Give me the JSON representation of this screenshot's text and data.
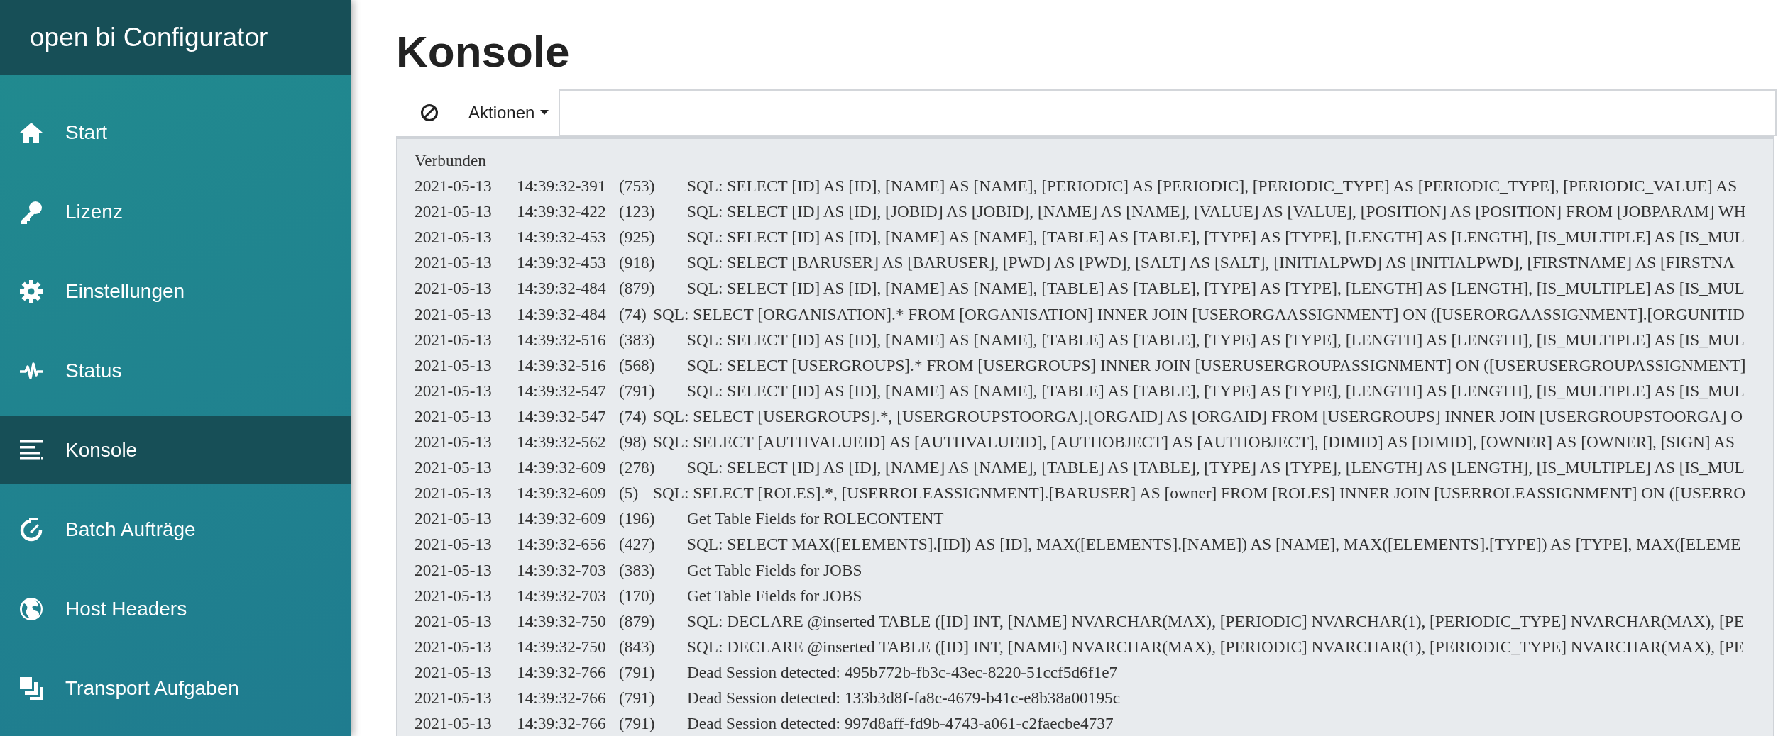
{
  "sidebar": {
    "title": "open bi Configurator",
    "items": [
      {
        "label": "Start",
        "selected": false
      },
      {
        "label": "Lizenz",
        "selected": false
      },
      {
        "label": "Einstellungen",
        "selected": false
      },
      {
        "label": "Status",
        "selected": false
      },
      {
        "label": "Konsole",
        "selected": true
      },
      {
        "label": "Batch Aufträge",
        "selected": false
      },
      {
        "label": "Host Headers",
        "selected": false
      },
      {
        "label": "Transport Aufgaben",
        "selected": false
      }
    ]
  },
  "page": {
    "title": "Konsole"
  },
  "toolbar": {
    "actions_label": "Aktionen"
  },
  "log": {
    "status": "Verbunden",
    "entries": [
      {
        "date": "2021-05-13",
        "time": "14:39:32-391",
        "pid": "(753)",
        "message": "SQL: SELECT [ID] AS [ID], [NAME] AS [NAME], [PERIODIC] AS [PERIODIC], [PERIODIC_TYPE] AS [PERIODIC_TYPE], [PERIODIC_VALUE] AS"
      },
      {
        "date": "2021-05-13",
        "time": "14:39:32-422",
        "pid": "(123)",
        "message": "SQL: SELECT [ID] AS [ID], [JOBID] AS [JOBID], [NAME] AS [NAME], [VALUE] AS [VALUE], [POSITION] AS [POSITION] FROM [JOBPARAM] WH"
      },
      {
        "date": "2021-05-13",
        "time": "14:39:32-453",
        "pid": "(925)",
        "message": "SQL: SELECT [ID] AS [ID], [NAME] AS [NAME], [TABLE] AS [TABLE], [TYPE] AS [TYPE], [LENGTH] AS [LENGTH], [IS_MULTIPLE] AS [IS_MUL"
      },
      {
        "date": "2021-05-13",
        "time": "14:39:32-453",
        "pid": "(918)",
        "message": "SQL: SELECT [BARUSER] AS [BARUSER], [PWD] AS [PWD], [SALT] AS [SALT], [INITIALPWD] AS [INITIALPWD], [FIRSTNAME] AS [FIRSTNA"
      },
      {
        "date": "2021-05-13",
        "time": "14:39:32-484",
        "pid": "(879)",
        "message": "SQL: SELECT [ID] AS [ID], [NAME] AS [NAME], [TABLE] AS [TABLE], [TYPE] AS [TYPE], [LENGTH] AS [LENGTH], [IS_MULTIPLE] AS [IS_MUL"
      },
      {
        "date": "2021-05-13",
        "time": "14:39:32-484",
        "pid": "(74)",
        "message": "SQL: SELECT [ORGANISATION].* FROM [ORGANISATION] INNER JOIN [USERORGAASSIGNMENT] ON ([USERORGAASSIGNMENT].[ORGUNITID"
      },
      {
        "date": "2021-05-13",
        "time": "14:39:32-516",
        "pid": "(383)",
        "message": "SQL: SELECT [ID] AS [ID], [NAME] AS [NAME], [TABLE] AS [TABLE], [TYPE] AS [TYPE], [LENGTH] AS [LENGTH], [IS_MULTIPLE] AS [IS_MUL"
      },
      {
        "date": "2021-05-13",
        "time": "14:39:32-516",
        "pid": "(568)",
        "message": "SQL: SELECT [USERGROUPS].* FROM [USERGROUPS] INNER JOIN [USERUSERGROUPASSIGNMENT] ON ([USERUSERGROUPASSIGNMENT]"
      },
      {
        "date": "2021-05-13",
        "time": "14:39:32-547",
        "pid": "(791)",
        "message": "SQL: SELECT [ID] AS [ID], [NAME] AS [NAME], [TABLE] AS [TABLE], [TYPE] AS [TYPE], [LENGTH] AS [LENGTH], [IS_MULTIPLE] AS [IS_MUL"
      },
      {
        "date": "2021-05-13",
        "time": "14:39:32-547",
        "pid": "(74)",
        "message": "SQL: SELECT [USERGROUPS].*, [USERGROUPSTOORGA].[ORGAID] AS [ORGAID] FROM [USERGROUPS] INNER JOIN [USERGROUPSTOORGA] O"
      },
      {
        "date": "2021-05-13",
        "time": "14:39:32-562",
        "pid": "(98)",
        "message": "SQL: SELECT [AUTHVALUEID] AS [AUTHVALUEID], [AUTHOBJECT] AS [AUTHOBJECT], [DIMID] AS [DIMID], [OWNER] AS [OWNER], [SIGN] AS"
      },
      {
        "date": "2021-05-13",
        "time": "14:39:32-609",
        "pid": "(278)",
        "message": "SQL: SELECT [ID] AS [ID], [NAME] AS [NAME], [TABLE] AS [TABLE], [TYPE] AS [TYPE], [LENGTH] AS [LENGTH], [IS_MULTIPLE] AS [IS_MUL"
      },
      {
        "date": "2021-05-13",
        "time": "14:39:32-609",
        "pid": "(5)",
        "message": "SQL: SELECT [ROLES].*, [USERROLEASSIGNMENT].[BARUSER] AS [owner] FROM [ROLES] INNER JOIN [USERROLEASSIGNMENT] ON ([USERRO"
      },
      {
        "date": "2021-05-13",
        "time": "14:39:32-609",
        "pid": "(196)",
        "message": "Get Table Fields for ROLECONTENT"
      },
      {
        "date": "2021-05-13",
        "time": "14:39:32-656",
        "pid": "(427)",
        "message": "SQL: SELECT MAX([ELEMENTS].[ID]) AS [ID], MAX([ELEMENTS].[NAME]) AS [NAME], MAX([ELEMENTS].[TYPE]) AS [TYPE], MAX([ELEME"
      },
      {
        "date": "2021-05-13",
        "time": "14:39:32-703",
        "pid": "(383)",
        "message": "Get Table Fields for JOBS"
      },
      {
        "date": "2021-05-13",
        "time": "14:39:32-703",
        "pid": "(170)",
        "message": "Get Table Fields for JOBS"
      },
      {
        "date": "2021-05-13",
        "time": "14:39:32-750",
        "pid": "(879)",
        "message": "SQL: DECLARE @inserted TABLE ([ID] INT, [NAME] NVARCHAR(MAX), [PERIODIC] NVARCHAR(1), [PERIODIC_TYPE] NVARCHAR(MAX), [PE"
      },
      {
        "date": "2021-05-13",
        "time": "14:39:32-750",
        "pid": "(843)",
        "message": "SQL: DECLARE @inserted TABLE ([ID] INT, [NAME] NVARCHAR(MAX), [PERIODIC] NVARCHAR(1), [PERIODIC_TYPE] NVARCHAR(MAX), [PE"
      },
      {
        "date": "2021-05-13",
        "time": "14:39:32-766",
        "pid": "(791)",
        "message": "Dead Session detected: 495b772b-fb3c-43ec-8220-51ccf5d6f1e7"
      },
      {
        "date": "2021-05-13",
        "time": "14:39:32-766",
        "pid": "(791)",
        "message": "Dead Session detected: 133b3d8f-fa8c-4679-b41c-e8b38a00195c"
      },
      {
        "date": "2021-05-13",
        "time": "14:39:32-766",
        "pid": "(791)",
        "message": "Dead Session detected: 997d8aff-fd9b-4743-a061-c2faecbe4737"
      }
    ]
  }
}
